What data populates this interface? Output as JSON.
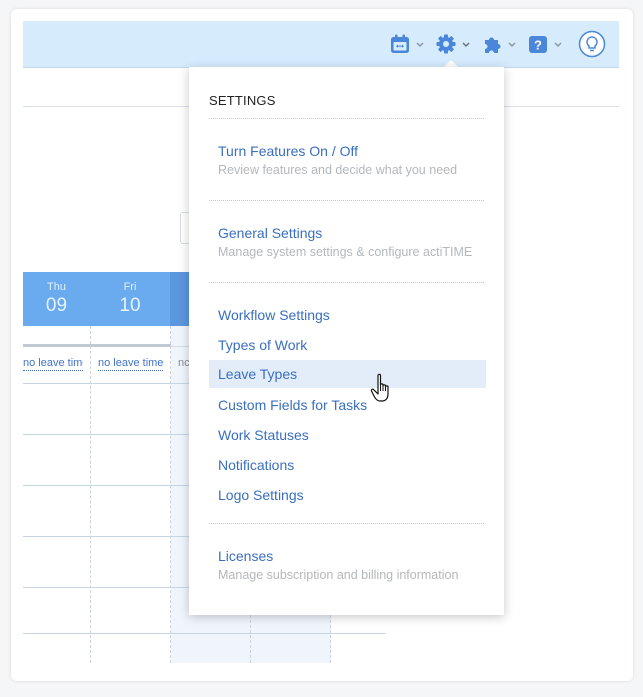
{
  "toolbar": {
    "items": [
      {
        "icon": "calendar-icon",
        "has_caret": true
      },
      {
        "icon": "gear-icon",
        "has_caret": true,
        "active": true
      },
      {
        "icon": "puzzle-icon",
        "has_caret": true
      },
      {
        "icon": "help-icon",
        "glyph": "?",
        "has_caret": true
      },
      {
        "icon": "lightbulb-icon",
        "has_caret": false
      }
    ],
    "colors": {
      "background": "#d6ecfd",
      "icon": "#4a86d9",
      "caret": "#8a96a3"
    }
  },
  "calendar": {
    "days": [
      {
        "dow": "Thu",
        "num": "09"
      },
      {
        "dow": "Fri",
        "num": "10"
      }
    ],
    "leave_labels": [
      "no leave time",
      "no leave time",
      "nc"
    ],
    "colors": {
      "header": "#6aaaee",
      "header_dark": "#5b97df"
    }
  },
  "settings_menu": {
    "title": "SETTINGS",
    "sections": [
      {
        "items": [
          {
            "label": "Turn Features On / Off",
            "description": "Review features and decide what you need"
          }
        ]
      },
      {
        "items": [
          {
            "label": "General Settings",
            "description": "Manage system settings & configure actiTIME"
          }
        ]
      },
      {
        "items": [
          {
            "label": "Workflow Settings"
          },
          {
            "label": "Types of Work"
          },
          {
            "label": "Leave Types",
            "hovered": true
          },
          {
            "label": "Custom Fields for Tasks"
          },
          {
            "label": "Work Statuses"
          },
          {
            "label": "Notifications"
          },
          {
            "label": "Logo Settings"
          }
        ]
      },
      {
        "items": [
          {
            "label": "Licenses",
            "description": "Manage subscription and billing information"
          }
        ]
      }
    ],
    "colors": {
      "link": "#3a6fbf",
      "description": "#b3b8bd",
      "hover_bg": "#e2edf9"
    }
  }
}
